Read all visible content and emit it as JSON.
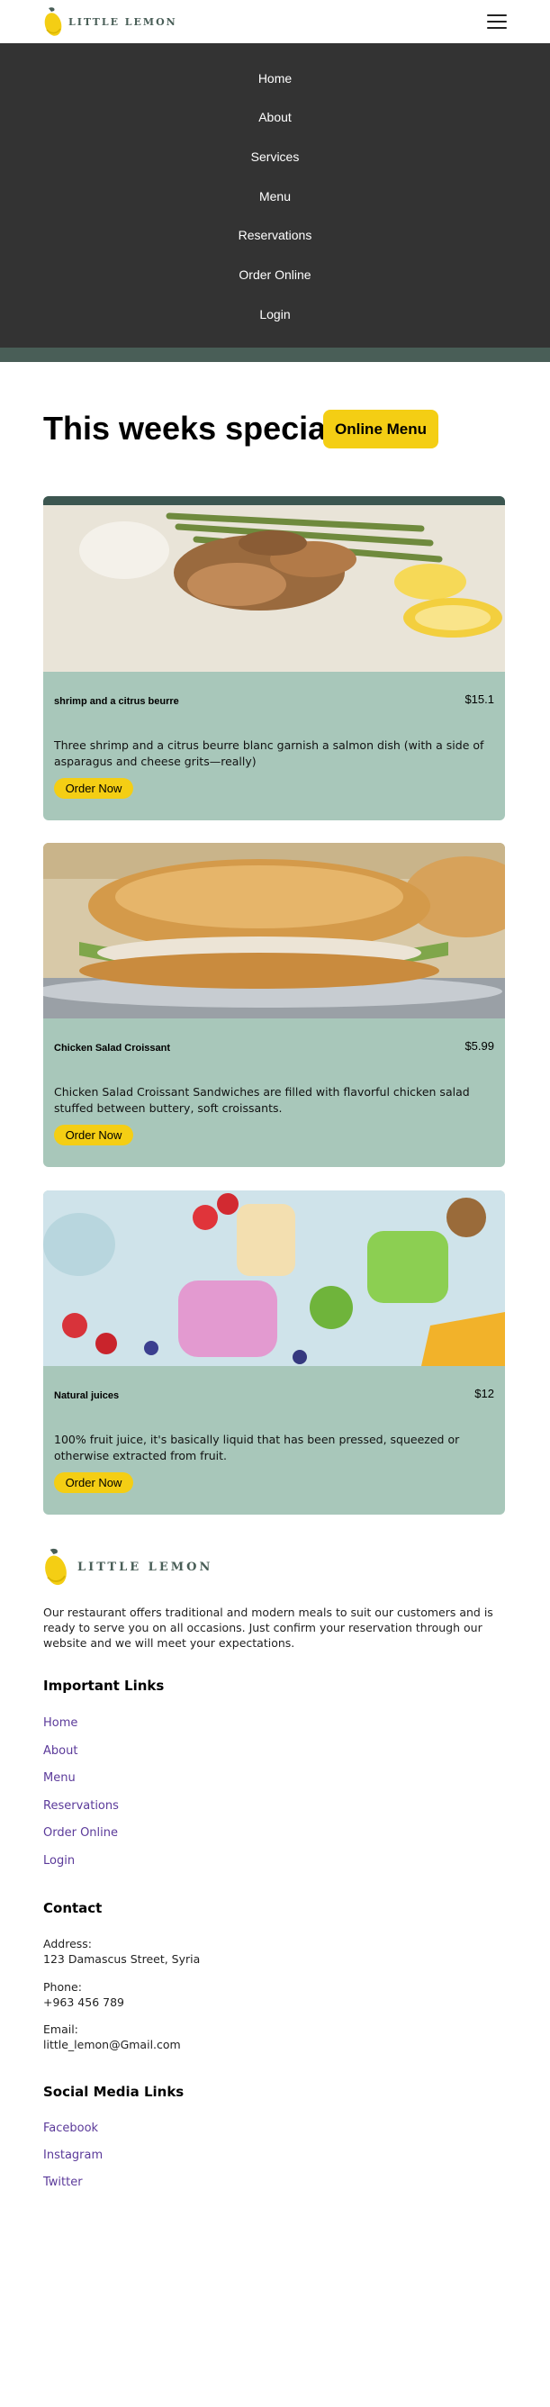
{
  "brand": {
    "name": "LITTLE LEMON",
    "colors": {
      "primary": "#495e57",
      "accent": "#f4ce14",
      "card": "#a8c7ba",
      "nav": "#333333"
    }
  },
  "header": {
    "menu_icon": "hamburger-menu-icon"
  },
  "nav": {
    "items": [
      "Home",
      "About",
      "Services",
      "Menu",
      "Reservations",
      "Order Online",
      "Login"
    ]
  },
  "specials": {
    "title": "This weeks specials!",
    "online_menu_label": "Online Menu",
    "cards": [
      {
        "name": "shrimp and a citrus beurre",
        "price": "$15.1",
        "description": "Three shrimp and a citrus beurre blanc garnish a salmon dish (with a side of asparagus and cheese grits—really)",
        "button": "Order Now"
      },
      {
        "name": "Chicken Salad Croissant",
        "price": "$5.99",
        "description": "Chicken Salad Croissant Sandwiches are filled with flavorful chicken salad stuffed between buttery, soft croissants.",
        "button": "Order Now"
      },
      {
        "name": "Natural juices",
        "price": "$12",
        "description": "100% fruit juice, it's basically liquid that has been pressed, squeezed or otherwise extracted from fruit.",
        "button": "Order Now"
      }
    ]
  },
  "footer": {
    "about": "Our restaurant offers traditional and modern meals to suit our customers and is ready to serve you on all occasions. Just confirm your reservation through our website and we will meet your expectations.",
    "important_links_title": "Important Links",
    "important_links": [
      "Home",
      "About",
      "Menu",
      "Reservations",
      "Order Online",
      "Login"
    ],
    "contact_title": "Contact",
    "contact": {
      "address_label": "Address:",
      "address": "123 Damascus Street, Syria",
      "phone_label": "Phone:",
      "phone": "+963 456 789",
      "email_label": "Email:",
      "email": "little_lemon@Gmail.com"
    },
    "social_title": "Social Media Links",
    "social_links": [
      "Facebook",
      "Instagram",
      "Twitter"
    ]
  }
}
